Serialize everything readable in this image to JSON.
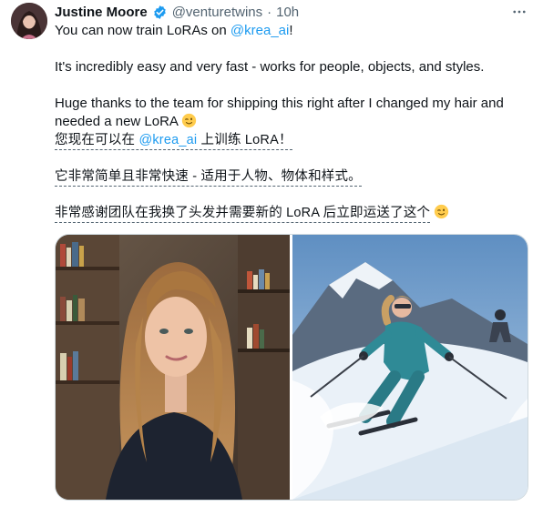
{
  "author": {
    "name": "Justine Moore",
    "handle": "@venturetwins",
    "separator": "·",
    "time": "10h"
  },
  "icons": {
    "verified": "verified-badge-icon",
    "more": "more-options-icon",
    "emoji": "winking-face-emoji"
  },
  "tweet": {
    "line1_prefix": "You can now train LoRAs on ",
    "line1_mention": "@krea_ai",
    "line1_suffix": "!",
    "line2": "It's incredibly easy and very fast - works for people, objects, and styles.",
    "line3": "Huge thanks to the team for shipping this right after I changed my hair and",
    "line4": "needed a new LoRA"
  },
  "translation": {
    "line1_prefix": "您现在可以在 ",
    "line1_mention": "@krea_ai",
    "line1_suffix": " 上训练 LoRA！",
    "line2": "它非常简单且非常快速 - 适用于人物、物体和样式。",
    "line3": "非常感谢团队在我换了头发并需要新的 LoRA 后立即运送了这个"
  },
  "colors": {
    "text": "#0f1419",
    "secondary": "#536471",
    "link": "#1d9bf0",
    "border": "#cfd9de"
  }
}
